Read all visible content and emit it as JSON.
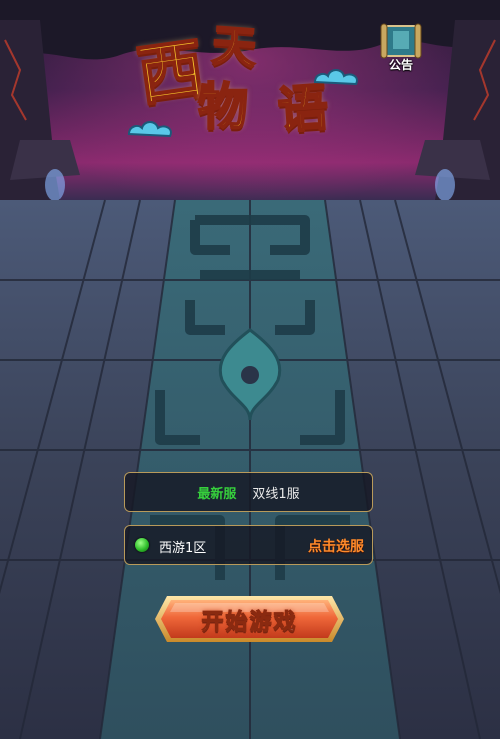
{
  "game": {
    "title_chars": [
      "西",
      "天",
      "物",
      "语"
    ]
  },
  "notice": {
    "label": "公告"
  },
  "server": {
    "newest_tag": "最新服",
    "line_name": "双线1服"
  },
  "zone": {
    "name": "西游1区",
    "select_label": "点击选服"
  },
  "start": {
    "label": "开始游戏"
  },
  "colors": {
    "panel_border": "#b89a5a",
    "newest_green": "#36d03c",
    "select_orange": "#ff8a2a",
    "start_button": "#f0683a",
    "logo_gold": "#f7c52b"
  }
}
